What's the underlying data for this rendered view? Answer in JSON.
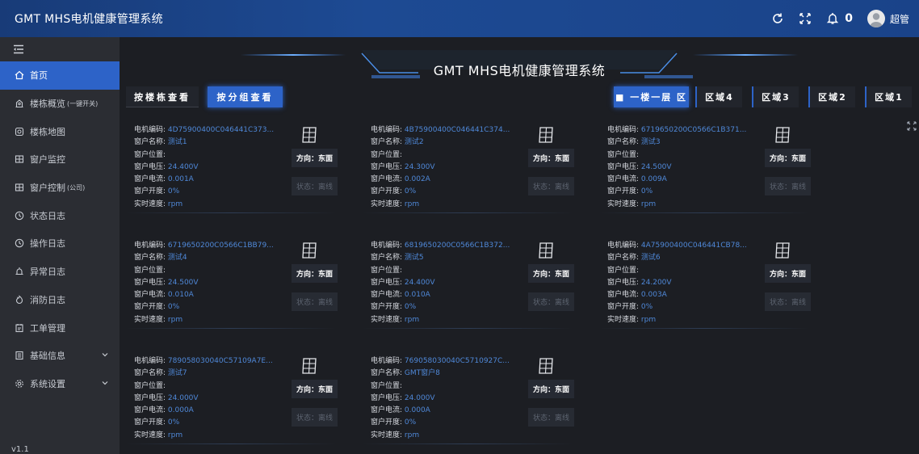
{
  "header": {
    "app_title": "GMT MHS电机健康管理系统",
    "bell_count": "0",
    "user_name": "超管",
    "icons": [
      "refresh-icon",
      "fullscreen-icon",
      "bell-icon",
      "avatar"
    ]
  },
  "sidebar": {
    "items": [
      {
        "label": "首页",
        "icon": "home-icon",
        "active": true
      },
      {
        "label": "楼栋概览",
        "sub": "(一键开关)",
        "icon": "building-icon"
      },
      {
        "label": "楼栋地图",
        "icon": "map-icon"
      },
      {
        "label": "窗户监控",
        "icon": "window-icon"
      },
      {
        "label": "窗户控制",
        "sub": "(公司)",
        "icon": "window-control-icon"
      },
      {
        "label": "状态日志",
        "icon": "clock-icon"
      },
      {
        "label": "操作日志",
        "icon": "clock-icon"
      },
      {
        "label": "异常日志",
        "icon": "alarm-icon"
      },
      {
        "label": "消防日志",
        "icon": "fire-icon"
      },
      {
        "label": "工单管理",
        "icon": "workorder-icon"
      },
      {
        "label": "基础信息",
        "icon": "info-icon",
        "chevron": true
      },
      {
        "label": "系统设置",
        "icon": "gear-icon",
        "chevron": true
      }
    ],
    "version": "v1.1"
  },
  "main": {
    "title": "GMT MHS电机健康管理系统",
    "view_buttons": {
      "building": "按楼栋查看",
      "group": "按分组查看"
    },
    "regions": [
      "区域1",
      "区域2",
      "区域3",
      "区域4"
    ],
    "active_region_label": "■ 一楼一层 区"
  },
  "labels": {
    "code": "电机编码:",
    "name": "窗户名称:",
    "position": "窗户位置:",
    "voltage": "窗户电压:",
    "current": "窗户电流:",
    "opening": "窗户开度:",
    "speed": "实时速度:",
    "direction": "方向：东面",
    "status": "状态：离线"
  },
  "cards": [
    {
      "code": "4D75900400C046441C373...",
      "name": "测试1",
      "position": "",
      "voltage": "24.400V",
      "current": "0.001A",
      "opening": "0%",
      "speed": "rpm"
    },
    {
      "code": "4B75900400C046441C374...",
      "name": "测试2",
      "position": "",
      "voltage": "24.300V",
      "current": "0.002A",
      "opening": "0%",
      "speed": "rpm"
    },
    {
      "code": "6719650200C0566C1B371...",
      "name": "测试3",
      "position": "",
      "voltage": "24.500V",
      "current": "0.009A",
      "opening": "0%",
      "speed": "rpm"
    },
    {
      "code": "6719650200C0566C1BB79...",
      "name": "测试4",
      "position": "",
      "voltage": "24.500V",
      "current": "0.010A",
      "opening": "0%",
      "speed": "rpm"
    },
    {
      "code": "6819650200C0566C1B372...",
      "name": "测试5",
      "position": "",
      "voltage": "24.400V",
      "current": "0.010A",
      "opening": "0%",
      "speed": "rpm"
    },
    {
      "code": "4A75900400C046441CB78...",
      "name": "测试6",
      "position": "",
      "voltage": "24.200V",
      "current": "0.003A",
      "opening": "0%",
      "speed": "rpm"
    },
    {
      "code": "789058030040C57109A7E...",
      "name": "测试7",
      "position": "",
      "voltage": "24.000V",
      "current": "0.000A",
      "opening": "0%",
      "speed": "rpm"
    },
    {
      "code": "769058030040C5710927C...",
      "name": "GMT窗户8",
      "position": "",
      "voltage": "24.000V",
      "current": "0.000A",
      "opening": "0%",
      "speed": "rpm"
    }
  ]
}
